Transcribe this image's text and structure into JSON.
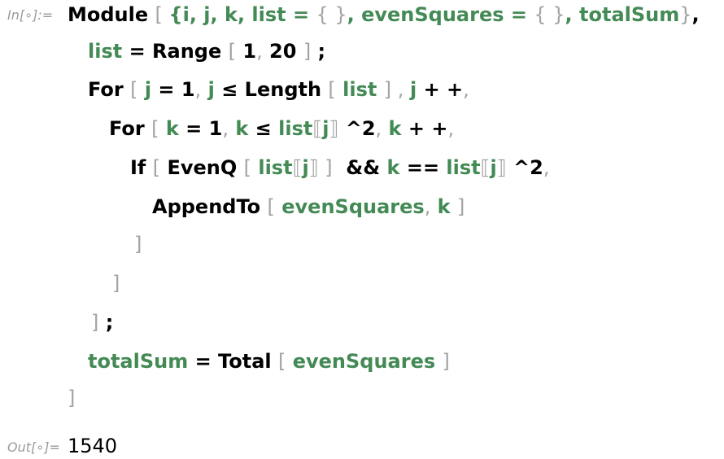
{
  "cells": {
    "input_label": "In[∘]:=",
    "output_label": "Out[∘]=",
    "output_value": "1540"
  },
  "code_lines": [
    [
      [
        "k",
        "Module "
      ],
      [
        "b",
        "[ "
      ],
      [
        "v",
        "{i, j, k, list = "
      ],
      [
        "b",
        "{ }"
      ],
      [
        "v",
        ", evenSquares = "
      ],
      [
        "b",
        "{ }"
      ],
      [
        "v",
        ", totalSum"
      ],
      [
        "b",
        "}"
      ],
      [
        "k",
        ","
      ]
    ],
    [
      [
        "v",
        "list"
      ],
      [
        "k",
        " = Range "
      ],
      [
        "b",
        "["
      ],
      [
        "k",
        " 1"
      ],
      [
        "b",
        ","
      ],
      [
        "k",
        " 20 "
      ],
      [
        "b",
        "]"
      ],
      [
        "k",
        " ;"
      ]
    ],
    [
      [
        "k",
        "For "
      ],
      [
        "b",
        "["
      ],
      [
        "v",
        " j"
      ],
      [
        "k",
        " = 1"
      ],
      [
        "b",
        ","
      ],
      [
        "v",
        " j"
      ],
      [
        "k",
        " ≤ Length "
      ],
      [
        "b",
        "["
      ],
      [
        "v",
        " list "
      ],
      [
        "b",
        "]"
      ],
      [
        "b",
        " , "
      ],
      [
        "v",
        "j"
      ],
      [
        "k",
        " + +"
      ],
      [
        "b",
        ","
      ]
    ],
    [
      [
        "k",
        "For "
      ],
      [
        "b",
        "["
      ],
      [
        "v",
        " k"
      ],
      [
        "k",
        " = 1"
      ],
      [
        "b",
        ","
      ],
      [
        "v",
        " k"
      ],
      [
        "k",
        " ≤ "
      ],
      [
        "v",
        "list"
      ],
      [
        "b",
        "⟦"
      ],
      [
        "v",
        "j"
      ],
      [
        "b",
        "⟧"
      ],
      [
        "k",
        " ^2"
      ],
      [
        "b",
        ","
      ],
      [
        "v",
        " k"
      ],
      [
        "k",
        " + +"
      ],
      [
        "b",
        ","
      ]
    ],
    [
      [
        "k",
        "If "
      ],
      [
        "b",
        "["
      ],
      [
        "k",
        " EvenQ "
      ],
      [
        "b",
        "["
      ],
      [
        "v",
        " list"
      ],
      [
        "b",
        "⟦"
      ],
      [
        "v",
        "j"
      ],
      [
        "b",
        "⟧ ]"
      ],
      [
        "k",
        "  && "
      ],
      [
        "v",
        "k"
      ],
      [
        "k",
        " == "
      ],
      [
        "v",
        "list"
      ],
      [
        "b",
        "⟦"
      ],
      [
        "v",
        "j"
      ],
      [
        "b",
        "⟧"
      ],
      [
        "k",
        " ^2"
      ],
      [
        "b",
        ","
      ]
    ],
    [
      [
        "k",
        "AppendTo "
      ],
      [
        "b",
        "["
      ],
      [
        "v",
        " evenSquares"
      ],
      [
        "b",
        ","
      ],
      [
        "v",
        " k "
      ],
      [
        "b",
        "]"
      ]
    ],
    [
      [
        "b",
        "]"
      ]
    ],
    [
      [
        "b",
        "]"
      ]
    ],
    [
      [
        "b",
        "]"
      ],
      [
        "k",
        " ;"
      ]
    ],
    [
      [
        "v",
        "totalSum"
      ],
      [
        "k",
        " = Total "
      ],
      [
        "b",
        "["
      ],
      [
        "v",
        " evenSquares "
      ],
      [
        "b",
        "]"
      ]
    ],
    [
      [
        "b",
        "]"
      ]
    ]
  ]
}
